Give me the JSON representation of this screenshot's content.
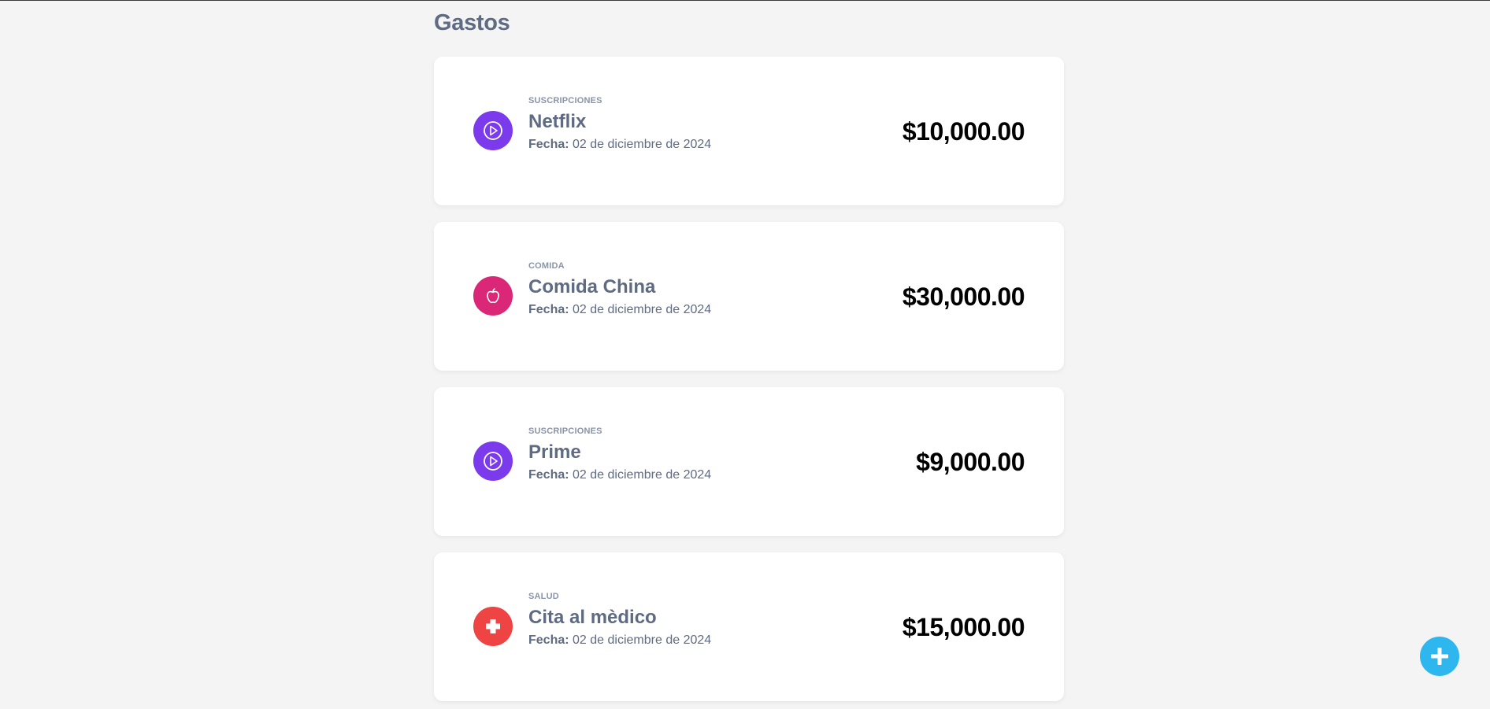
{
  "page": {
    "title": "Gastos"
  },
  "colors": {
    "background": "#f4f4f4",
    "title_text": "#5e6b82",
    "suscripciones": "#7c3aed",
    "comida": "#db2777",
    "salud": "#ef4444",
    "fab": "#2eb6ee"
  },
  "expenses": [
    {
      "category": "SUSCRIPCIONES",
      "name": "Netflix",
      "date_label": "Fecha:",
      "date": "02 de diciembre de 2024",
      "amount": "$10,000.00",
      "icon": "play-circle-icon",
      "color": "#7c3aed"
    },
    {
      "category": "COMIDA",
      "name": "Comida China",
      "date_label": "Fecha:",
      "date": "02 de diciembre de 2024",
      "amount": "$30,000.00",
      "icon": "apple-icon",
      "color": "#db2777"
    },
    {
      "category": "SUSCRIPCIONES",
      "name": "Prime",
      "date_label": "Fecha:",
      "date": "02 de diciembre de 2024",
      "amount": "$9,000.00",
      "icon": "play-circle-icon",
      "color": "#7c3aed"
    },
    {
      "category": "SALUD",
      "name": "Cita al mèdico",
      "date_label": "Fecha:",
      "date": "02 de diciembre de 2024",
      "amount": "$15,000.00",
      "icon": "medical-cross-icon",
      "color": "#ef4444"
    }
  ],
  "fab": {
    "icon": "plus-icon"
  }
}
